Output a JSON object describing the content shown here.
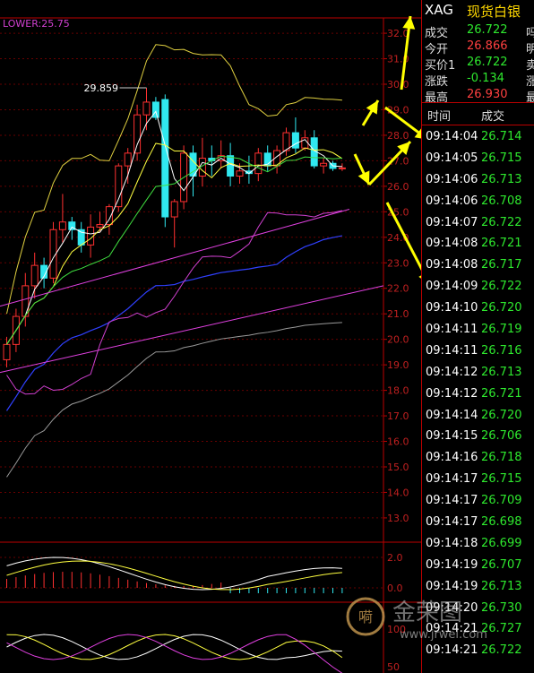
{
  "indicator": {
    "label": "LOWER:25.75"
  },
  "chart_data": {
    "type": "candlestick",
    "annotation_high": "29.859",
    "y_ticks": [
      "32.0",
      "31.0",
      "30.0",
      "29.0",
      "28.0",
      "27.0",
      "26.0",
      "25.0",
      "24.0",
      "23.0",
      "22.0",
      "21.0",
      "20.0",
      "19.0",
      "18.0",
      "17.0",
      "16.0",
      "15.0",
      "14.0",
      "13.0"
    ],
    "ylim": [
      12.4,
      32.6
    ],
    "candles": [
      [
        19.2,
        20.1,
        18.9,
        19.8
      ],
      [
        19.8,
        21.2,
        19.5,
        20.9
      ],
      [
        20.9,
        22.6,
        20.5,
        22.1
      ],
      [
        22.1,
        23.4,
        21.6,
        22.9
      ],
      [
        22.9,
        23.2,
        22.0,
        22.4
      ],
      [
        22.4,
        24.6,
        22.2,
        24.3
      ],
      [
        24.3,
        25.7,
        23.8,
        24.6
      ],
      [
        24.6,
        24.8,
        23.9,
        24.3
      ],
      [
        24.3,
        24.6,
        23.4,
        23.7
      ],
      [
        23.7,
        24.9,
        23.2,
        24.4
      ],
      [
        24.4,
        25.0,
        24.2,
        24.5
      ],
      [
        24.5,
        25.3,
        24.1,
        25.2
      ],
      [
        25.2,
        26.9,
        25.0,
        26.8
      ],
      [
        26.8,
        27.5,
        26.1,
        27.3
      ],
      [
        27.3,
        29.2,
        27.0,
        28.8
      ],
      [
        28.8,
        29.86,
        28.2,
        29.3
      ],
      [
        29.3,
        29.5,
        28.6,
        28.7
      ],
      [
        29.4,
        29.6,
        24.4,
        24.8
      ],
      [
        24.8,
        25.5,
        23.6,
        25.4
      ],
      [
        25.4,
        27.6,
        25.1,
        27.3
      ],
      [
        27.3,
        27.6,
        25.6,
        26.4
      ],
      [
        26.4,
        27.9,
        26.0,
        27.1
      ],
      [
        27.1,
        27.6,
        26.4,
        27.0
      ],
      [
        27.0,
        27.8,
        26.7,
        27.2
      ],
      [
        27.2,
        27.7,
        26.0,
        26.4
      ],
      [
        26.4,
        26.9,
        26.1,
        26.6
      ],
      [
        26.6,
        27.2,
        26.1,
        26.5
      ],
      [
        26.5,
        27.5,
        26.2,
        27.3
      ],
      [
        27.3,
        27.6,
        26.6,
        26.8
      ],
      [
        26.8,
        27.6,
        26.5,
        27.4
      ],
      [
        27.4,
        28.3,
        27.2,
        28.1
      ],
      [
        28.1,
        28.7,
        27.3,
        27.5
      ],
      [
        27.5,
        28.2,
        27.4,
        27.9
      ],
      [
        27.9,
        28.2,
        26.7,
        26.8
      ],
      [
        26.8,
        27.1,
        26.5,
        26.9
      ],
      [
        26.9,
        27.0,
        26.6,
        26.7
      ],
      [
        26.7,
        26.9,
        26.6,
        26.72
      ]
    ],
    "lower_panel_ticks": [
      "2.0",
      "0.0"
    ],
    "bottom_panel_ticks": [
      "100",
      "50"
    ]
  },
  "quote": {
    "symbol": "XAG",
    "name": "现货白银",
    "rows": [
      {
        "label": "成交",
        "value": "26.722",
        "color": "#2ee82e",
        "cut": "吗"
      },
      {
        "label": "今开",
        "value": "26.866",
        "color": "#ff4040",
        "cut": "明"
      },
      {
        "label": "买价1",
        "value": "26.722",
        "color": "#2ee82e",
        "cut": "卖"
      },
      {
        "label": "涨跌",
        "value": "-0.134",
        "color": "#2ee82e",
        "cut": "涨"
      },
      {
        "label": "最高",
        "value": "26.930",
        "color": "#ff4040",
        "cut": "最"
      }
    ]
  },
  "trades": {
    "headers": {
      "time": "时间",
      "price": "成交"
    },
    "rows": [
      {
        "time": "09:14:04",
        "price": "26.714"
      },
      {
        "time": "09:14:05",
        "price": "26.715"
      },
      {
        "time": "09:14:06",
        "price": "26.713"
      },
      {
        "time": "09:14:06",
        "price": "26.708"
      },
      {
        "time": "09:14:07",
        "price": "26.722"
      },
      {
        "time": "09:14:08",
        "price": "26.721"
      },
      {
        "time": "09:14:08",
        "price": "26.717"
      },
      {
        "time": "09:14:09",
        "price": "26.722"
      },
      {
        "time": "09:14:10",
        "price": "26.720"
      },
      {
        "time": "09:14:11",
        "price": "26.719"
      },
      {
        "time": "09:14:11",
        "price": "26.716"
      },
      {
        "time": "09:14:12",
        "price": "26.713"
      },
      {
        "time": "09:14:12",
        "price": "26.721"
      },
      {
        "time": "09:14:14",
        "price": "26.720"
      },
      {
        "time": "09:14:15",
        "price": "26.706"
      },
      {
        "time": "09:14:16",
        "price": "26.718"
      },
      {
        "time": "09:14:17",
        "price": "26.715"
      },
      {
        "time": "09:14:17",
        "price": "26.709"
      },
      {
        "time": "09:14:17",
        "price": "26.698"
      },
      {
        "time": "09:14:18",
        "price": "26.699"
      },
      {
        "time": "09:14:19",
        "price": "26.707"
      },
      {
        "time": "09:14:19",
        "price": "26.713"
      },
      {
        "time": "09:14:20",
        "price": "26.730"
      },
      {
        "time": "09:14:21",
        "price": "26.727"
      },
      {
        "time": "09:14:21",
        "price": "26.722"
      }
    ]
  },
  "watermark": {
    "brand": "金荣图",
    "url": "www.jrwei.com"
  }
}
